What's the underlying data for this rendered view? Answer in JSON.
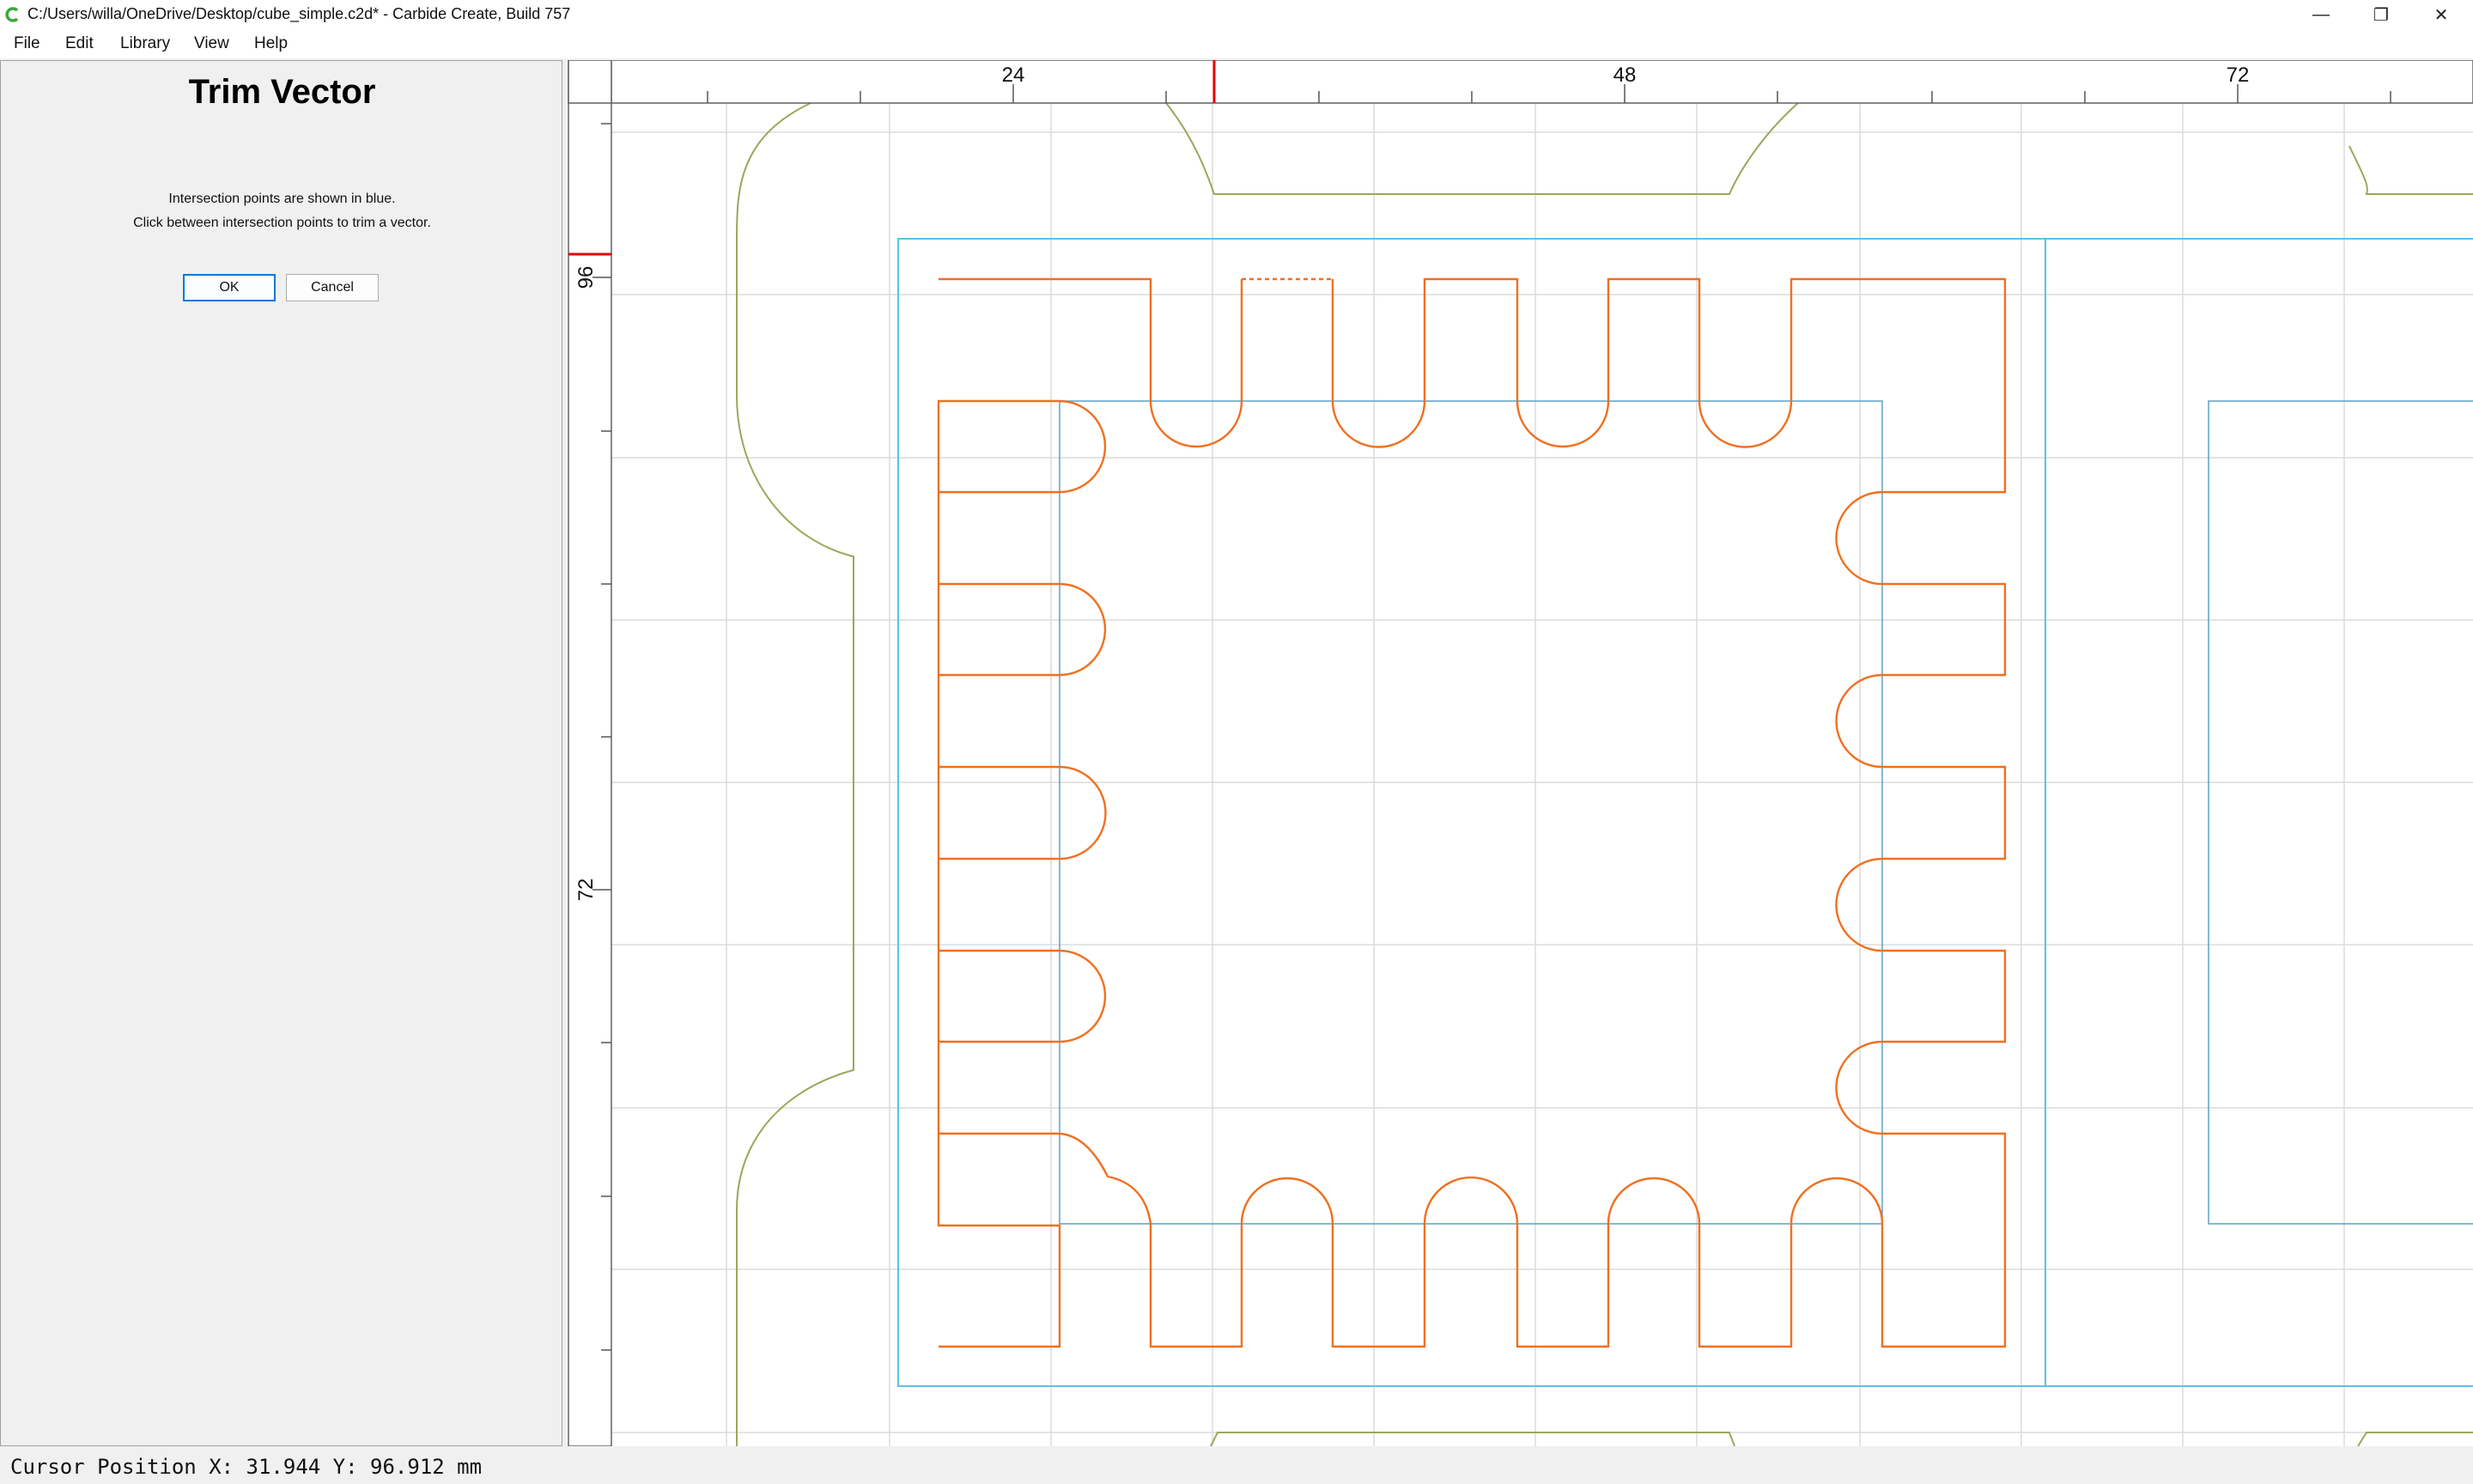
{
  "window": {
    "title": "C:/Users/willa/OneDrive/Desktop/cube_simple.c2d* - Carbide Create, Build 757",
    "icon": "carbide-create-icon",
    "controls": [
      "minimize-icon",
      "restore-icon",
      "close-icon"
    ]
  },
  "menu": {
    "file": "File",
    "edit": "Edit",
    "library": "Library",
    "view": "View",
    "help": "Help"
  },
  "panel": {
    "title": "Trim Vector",
    "line1": "Intersection points are shown in blue.",
    "line2": "Click between intersection points to trim a vector.",
    "ok": "OK",
    "cancel": "Cancel"
  },
  "rulers": {
    "top_labels": [
      "24",
      "48",
      "72"
    ],
    "left_labels": [
      "96",
      "72"
    ]
  },
  "colors": {
    "toolpath_orange": "#f07020",
    "intersection_blue": "#57c5e6",
    "outline_olive": "#9aa85a",
    "grid": "#d8d8d8",
    "cursor_marker": "#e00000"
  },
  "status": {
    "cursor_position": "Cursor Position X: 31.944 Y: 96.912 mm"
  }
}
